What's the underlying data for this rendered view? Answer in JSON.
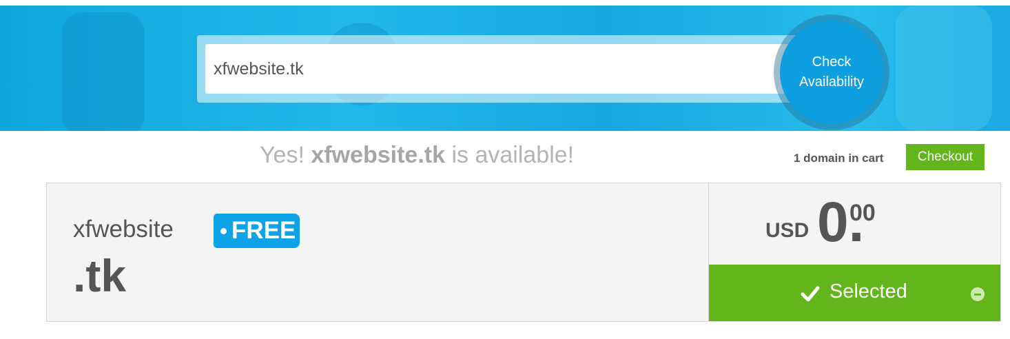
{
  "search": {
    "value": "xfwebsite.tk",
    "button_label": "Check\nAvailability"
  },
  "result": {
    "prefix": "Yes!",
    "domain": "xfwebsite.tk",
    "suffix": "is available!"
  },
  "cart": {
    "count_text": "1 domain in cart",
    "checkout_label": "Checkout"
  },
  "domain_card": {
    "sld": "xfwebsite",
    "tld": ".tk",
    "badge": "FREE",
    "currency": "USD",
    "price_int": "0.",
    "price_dec": "00",
    "selected_label": "Selected"
  },
  "colors": {
    "accent_blue": "#0ea3e6",
    "green": "#62b51a",
    "text_gray": "#555555"
  }
}
